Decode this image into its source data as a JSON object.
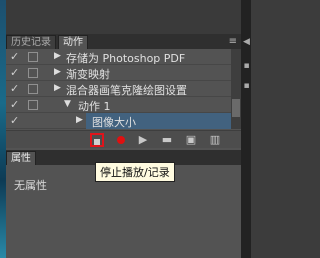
{
  "panel_tabs": {
    "history": "历史记录",
    "actions": "动作",
    "menu_icon": "≡"
  },
  "actions_list": [
    {
      "check": "✓",
      "label": "存储为 Photoshop PDF",
      "expanded": false
    },
    {
      "check": "✓",
      "label": "渐变映射",
      "expanded": false
    },
    {
      "check": "✓",
      "label": "混合器画笔克隆绘图设置",
      "expanded": false
    },
    {
      "check": "✓",
      "label": "动作 1",
      "expanded": true
    },
    {
      "check": "✓",
      "label": "图像大小",
      "expanded": false,
      "selected": true
    }
  ],
  "toolbar_icons": [
    "stop-icon",
    "record-icon",
    "play-icon",
    "folder-icon",
    "new-action-icon",
    "trash-icon"
  ],
  "tooltip": "停止播放/记录",
  "properties": {
    "tab_label": "属性",
    "empty_text": "无属性"
  },
  "colors": {
    "highlight_border": "#e0141b",
    "selection": "#42627f",
    "record": "#e01010"
  }
}
